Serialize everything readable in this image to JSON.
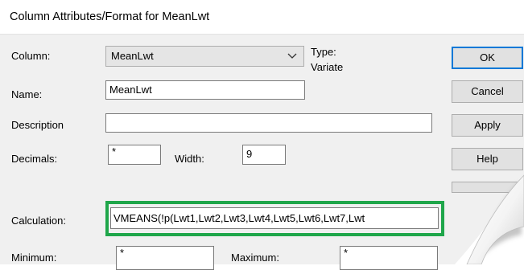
{
  "dialog": {
    "title": "Column Attributes/Format for MeanLwt"
  },
  "form": {
    "column_label": "Column:",
    "column_value": "MeanLwt",
    "type_label": "Type:",
    "type_value": "Variate",
    "name_label": "Name:",
    "name_value": "MeanLwt",
    "description_label": "Description",
    "description_value": "",
    "decimals_label": "Decimals:",
    "decimals_value": "*",
    "width_label": "Width:",
    "width_value": "9",
    "calculation_label": "Calculation:",
    "calculation_value": "VMEANS(!p(Lwt1,Lwt2,Lwt3,Lwt4,Lwt5,Lwt6,Lwt7,Lwt",
    "minimum_label": "Minimum:",
    "minimum_value": "*",
    "maximum_label": "Maximum:",
    "maximum_value": "*"
  },
  "buttons": {
    "ok": "OK",
    "cancel": "Cancel",
    "apply": "Apply",
    "help": "Help"
  },
  "colors": {
    "highlight": "#1fa64a",
    "default_button_border": "#0078d7"
  },
  "icons": {
    "dropdown": "chevron-down-icon"
  }
}
